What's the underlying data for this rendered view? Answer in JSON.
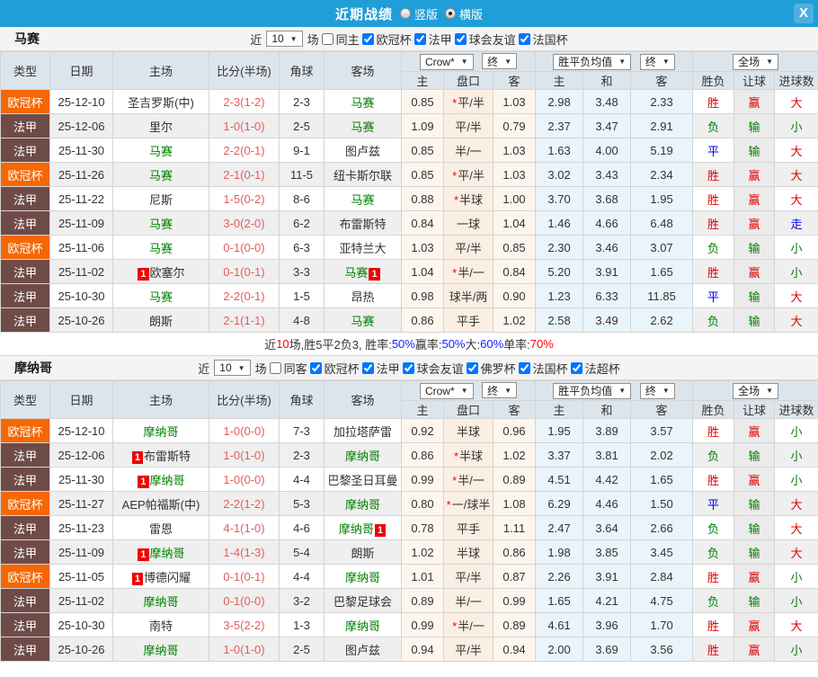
{
  "header": {
    "title": "近期战绩",
    "radios": [
      {
        "label": "竖版",
        "selected": false
      },
      {
        "label": "横版",
        "selected": true
      }
    ],
    "close_label": "X"
  },
  "columns": {
    "type": "类型",
    "date": "日期",
    "home": "主场",
    "score": "比分(半场)",
    "corner": "角球",
    "away": "客场",
    "asia": {
      "dd_company": "Crow*",
      "dd_time": "终",
      "home": "主",
      "handicap": "盘口",
      "away": "客"
    },
    "euro": {
      "dd_name": "胜平负均值",
      "dd_time": "终",
      "home": "主",
      "draw": "和",
      "away": "客"
    },
    "result": {
      "dd_scope": "全场",
      "wdl": "胜负",
      "handicap": "让球",
      "goals": "进球数"
    }
  },
  "misc": {
    "card_badge": "1",
    "dd_arrow": "▼"
  },
  "colors": {
    "topbar": "#1f9ed9",
    "ucl": "#f56702",
    "ligue1": "#6f4b47",
    "scorered": "#e65c5c",
    "grn": "#008000",
    "win_red": "#e00000",
    "lose_green": "#008000",
    "draw_blue": "#0000ee",
    "asia_bg": "#fdf6ee",
    "handicap_bg": "#fbefe3",
    "euro_bg": "#e9f4fb"
  },
  "sections": [
    {
      "team": "马赛",
      "filter": {
        "near": "近",
        "count": "10",
        "games": "场",
        "same": {
          "label": "同主",
          "checked": false
        },
        "competitions": [
          {
            "label": "欧冠杯",
            "checked": true
          },
          {
            "label": "法甲",
            "checked": true
          },
          {
            "label": "球会友谊",
            "checked": true
          },
          {
            "label": "法国杯",
            "checked": true
          }
        ]
      },
      "rows": [
        {
          "type": "欧冠杯",
          "date": "25-12-10",
          "home": "圣吉罗斯(中)",
          "score": "2-3(1-2)",
          "corner": "2-3",
          "away": "马赛",
          "asia": [
            "0.85",
            "平/半",
            "1.03"
          ],
          "star": true,
          "euro": [
            "2.98",
            "3.48",
            "2.33"
          ],
          "res": [
            "胜",
            "赢",
            "大"
          ]
        },
        {
          "type": "法甲",
          "date": "25-12-06",
          "home": "里尔",
          "score": "1-0(1-0)",
          "corner": "2-5",
          "away": "马赛",
          "asia": [
            "1.09",
            "平/半",
            "0.79"
          ],
          "star": false,
          "euro": [
            "2.37",
            "3.47",
            "2.91"
          ],
          "res": [
            "负",
            "输",
            "小"
          ]
        },
        {
          "type": "法甲",
          "date": "25-11-30",
          "home": "马赛",
          "score": "2-2(0-1)",
          "corner": "9-1",
          "away": "图卢兹",
          "asia": [
            "0.85",
            "半/一",
            "1.03"
          ],
          "star": false,
          "euro": [
            "1.63",
            "4.00",
            "5.19"
          ],
          "res": [
            "平",
            "输",
            "大"
          ]
        },
        {
          "type": "欧冠杯",
          "date": "25-11-26",
          "home": "马赛",
          "score": "2-1(0-1)",
          "corner": "11-5",
          "away": "纽卡斯尔联",
          "asia": [
            "0.85",
            "平/半",
            "1.03"
          ],
          "star": true,
          "euro": [
            "3.02",
            "3.43",
            "2.34"
          ],
          "res": [
            "胜",
            "赢",
            "大"
          ]
        },
        {
          "type": "法甲",
          "date": "25-11-22",
          "home": "尼斯",
          "score": "1-5(0-2)",
          "corner": "8-6",
          "away": "马赛",
          "asia": [
            "0.88",
            "半球",
            "1.00"
          ],
          "star": true,
          "euro": [
            "3.70",
            "3.68",
            "1.95"
          ],
          "res": [
            "胜",
            "赢",
            "大"
          ]
        },
        {
          "type": "法甲",
          "date": "25-11-09",
          "home": "马赛",
          "score": "3-0(2-0)",
          "corner": "6-2",
          "away": "布雷斯特",
          "asia": [
            "0.84",
            "一球",
            "1.04"
          ],
          "star": false,
          "euro": [
            "1.46",
            "4.66",
            "6.48"
          ],
          "res": [
            "胜",
            "赢",
            "走"
          ]
        },
        {
          "type": "欧冠杯",
          "date": "25-11-06",
          "home": "马赛",
          "score": "0-1(0-0)",
          "corner": "6-3",
          "away": "亚特兰大",
          "asia": [
            "1.03",
            "平/半",
            "0.85"
          ],
          "star": false,
          "euro": [
            "2.30",
            "3.46",
            "3.07"
          ],
          "res": [
            "负",
            "输",
            "小"
          ]
        },
        {
          "type": "法甲",
          "date": "25-11-02",
          "home": "欧塞尔",
          "home_card": true,
          "score": "0-1(0-1)",
          "corner": "3-3",
          "away": "马赛",
          "away_card": true,
          "asia": [
            "1.04",
            "半/一",
            "0.84"
          ],
          "star": true,
          "euro": [
            "5.20",
            "3.91",
            "1.65"
          ],
          "res": [
            "胜",
            "赢",
            "小"
          ]
        },
        {
          "type": "法甲",
          "date": "25-10-30",
          "home": "马赛",
          "score": "2-2(0-1)",
          "corner": "1-5",
          "away": "昂热",
          "asia": [
            "0.98",
            "球半/两",
            "0.90"
          ],
          "star": false,
          "euro": [
            "1.23",
            "6.33",
            "11.85"
          ],
          "res": [
            "平",
            "输",
            "大"
          ]
        },
        {
          "type": "法甲",
          "date": "25-10-26",
          "home": "朗斯",
          "score": "2-1(1-1)",
          "corner": "4-8",
          "away": "马赛",
          "asia": [
            "0.86",
            "平手",
            "1.02"
          ],
          "star": false,
          "euro": [
            "2.58",
            "3.49",
            "2.62"
          ],
          "res": [
            "负",
            "输",
            "大"
          ]
        }
      ],
      "summary": [
        {
          "text": "近",
          "color": "black"
        },
        {
          "text": "10",
          "color": "red"
        },
        {
          "text": "场,胜5平2负3, 胜率:",
          "color": "black"
        },
        {
          "text": "50%",
          "color": "blue"
        },
        {
          "text": " 赢率:",
          "color": "black"
        },
        {
          "text": "50%",
          "color": "blue"
        },
        {
          "text": " 大:",
          "color": "black"
        },
        {
          "text": "60%",
          "color": "blue"
        },
        {
          "text": " 单率:",
          "color": "black"
        },
        {
          "text": "70%",
          "color": "red"
        }
      ]
    },
    {
      "team": "摩纳哥",
      "filter": {
        "near": "近",
        "count": "10",
        "games": "场",
        "same": {
          "label": "同客",
          "checked": false
        },
        "competitions": [
          {
            "label": "欧冠杯",
            "checked": true
          },
          {
            "label": "法甲",
            "checked": true
          },
          {
            "label": "球会友谊",
            "checked": true
          },
          {
            "label": "佛罗杯",
            "checked": true
          },
          {
            "label": "法国杯",
            "checked": true
          },
          {
            "label": "法超杯",
            "checked": true
          }
        ]
      },
      "rows": [
        {
          "type": "欧冠杯",
          "date": "25-12-10",
          "home": "摩纳哥",
          "score": "1-0(0-0)",
          "corner": "7-3",
          "away": "加拉塔萨雷",
          "asia": [
            "0.92",
            "半球",
            "0.96"
          ],
          "star": false,
          "euro": [
            "1.95",
            "3.89",
            "3.57"
          ],
          "res": [
            "胜",
            "赢",
            "小"
          ]
        },
        {
          "type": "法甲",
          "date": "25-12-06",
          "home": "布雷斯特",
          "home_card": true,
          "score": "1-0(1-0)",
          "corner": "2-3",
          "away": "摩纳哥",
          "asia": [
            "0.86",
            "半球",
            "1.02"
          ],
          "star": true,
          "euro": [
            "3.37",
            "3.81",
            "2.02"
          ],
          "res": [
            "负",
            "输",
            "小"
          ]
        },
        {
          "type": "法甲",
          "date": "25-11-30",
          "home": "摩纳哥",
          "home_card": true,
          "score": "1-0(0-0)",
          "corner": "4-4",
          "away": "巴黎圣日耳曼",
          "asia": [
            "0.99",
            "半/一",
            "0.89"
          ],
          "star": true,
          "euro": [
            "4.51",
            "4.42",
            "1.65"
          ],
          "res": [
            "胜",
            "赢",
            "小"
          ]
        },
        {
          "type": "欧冠杯",
          "date": "25-11-27",
          "home": "AEP帕福斯(中)",
          "score": "2-2(1-2)",
          "corner": "5-3",
          "away": "摩纳哥",
          "asia": [
            "0.80",
            "一/球半",
            "1.08"
          ],
          "star": true,
          "euro": [
            "6.29",
            "4.46",
            "1.50"
          ],
          "res": [
            "平",
            "输",
            "大"
          ]
        },
        {
          "type": "法甲",
          "date": "25-11-23",
          "home": "雷恩",
          "score": "4-1(1-0)",
          "corner": "4-6",
          "away": "摩纳哥",
          "away_card": true,
          "asia": [
            "0.78",
            "平手",
            "1.11"
          ],
          "star": false,
          "euro": [
            "2.47",
            "3.64",
            "2.66"
          ],
          "res": [
            "负",
            "输",
            "大"
          ]
        },
        {
          "type": "法甲",
          "date": "25-11-09",
          "home": "摩纳哥",
          "home_card": true,
          "score": "1-4(1-3)",
          "corner": "5-4",
          "away": "朗斯",
          "asia": [
            "1.02",
            "半球",
            "0.86"
          ],
          "star": false,
          "euro": [
            "1.98",
            "3.85",
            "3.45"
          ],
          "res": [
            "负",
            "输",
            "大"
          ]
        },
        {
          "type": "欧冠杯",
          "date": "25-11-05",
          "home": "博德闪耀",
          "home_card": true,
          "score": "0-1(0-1)",
          "corner": "4-4",
          "away": "摩纳哥",
          "asia": [
            "1.01",
            "平/半",
            "0.87"
          ],
          "star": false,
          "euro": [
            "2.26",
            "3.91",
            "2.84"
          ],
          "res": [
            "胜",
            "赢",
            "小"
          ]
        },
        {
          "type": "法甲",
          "date": "25-11-02",
          "home": "摩纳哥",
          "score": "0-1(0-0)",
          "corner": "3-2",
          "away": "巴黎足球会",
          "asia": [
            "0.89",
            "半/一",
            "0.99"
          ],
          "star": false,
          "euro": [
            "1.65",
            "4.21",
            "4.75"
          ],
          "res": [
            "负",
            "输",
            "小"
          ]
        },
        {
          "type": "法甲",
          "date": "25-10-30",
          "home": "南特",
          "score": "3-5(2-2)",
          "corner": "1-3",
          "away": "摩纳哥",
          "asia": [
            "0.99",
            "半/一",
            "0.89"
          ],
          "star": true,
          "euro": [
            "4.61",
            "3.96",
            "1.70"
          ],
          "res": [
            "胜",
            "赢",
            "大"
          ]
        },
        {
          "type": "法甲",
          "date": "25-10-26",
          "home": "摩纳哥",
          "score": "1-0(1-0)",
          "corner": "2-5",
          "away": "图卢兹",
          "asia": [
            "0.94",
            "平/半",
            "0.94"
          ],
          "star": false,
          "euro": [
            "2.00",
            "3.69",
            "3.56"
          ],
          "res": [
            "胜",
            "赢",
            "小"
          ]
        }
      ]
    }
  ]
}
